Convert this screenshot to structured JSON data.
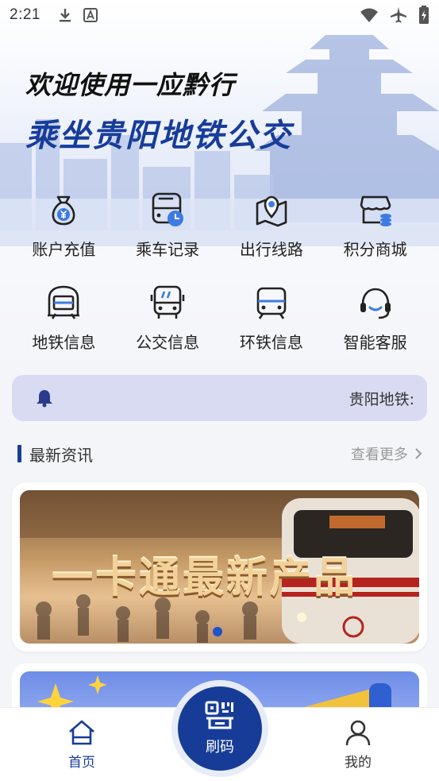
{
  "status_bar": {
    "time": "2:21",
    "icons": [
      "download-icon",
      "font-a-icon",
      "wifi-icon",
      "airplane-mode-icon",
      "battery-charging-icon"
    ]
  },
  "hero": {
    "greeting_line1": "欢迎使用一应黔行",
    "greeting_line2": "乘坐贵阳地铁公交"
  },
  "grid": [
    {
      "label": "账户充值",
      "icon": "money-bag-icon"
    },
    {
      "label": "乘车记录",
      "icon": "bus-clock-icon"
    },
    {
      "label": "出行线路",
      "icon": "map-pin-icon"
    },
    {
      "label": "积分商城",
      "icon": "store-coins-icon"
    },
    {
      "label": "地铁信息",
      "icon": "metro-icon"
    },
    {
      "label": "公交信息",
      "icon": "bus-icon"
    },
    {
      "label": "环铁信息",
      "icon": "train-icon"
    },
    {
      "label": "智能客服",
      "icon": "headset-icon"
    }
  ],
  "notice": {
    "icon": "bell-icon",
    "text": "贵阳地铁:"
  },
  "news": {
    "title": "最新资讯",
    "more_label": "查看更多"
  },
  "banner": {
    "title": "一卡通最新产品",
    "slide_index": 1
  },
  "tabbar": {
    "home_label": "首页",
    "scan_label": "刷码",
    "mine_label": "我的"
  },
  "colors": {
    "brand": "#173c97",
    "notice_bg": "#d9dbf3",
    "accent_blue": "#2f6bd8"
  }
}
